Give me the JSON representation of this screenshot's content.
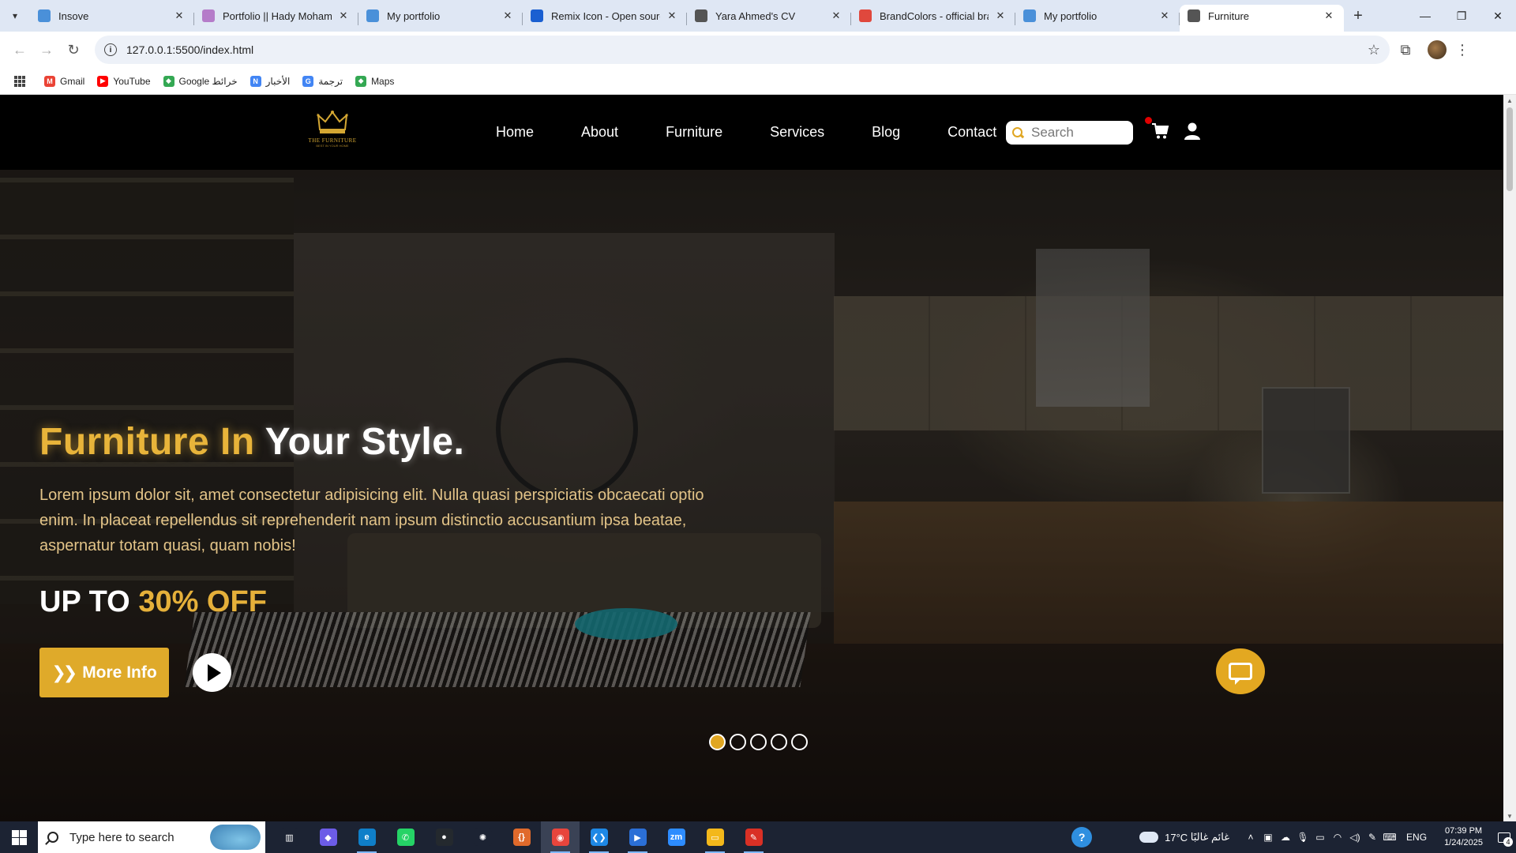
{
  "browser": {
    "tabs": [
      {
        "title": "Insove",
        "favicon_color": "#4a90d9",
        "active": false
      },
      {
        "title": "Portfolio || Hady Mohamed",
        "favicon_color": "#b57cc9",
        "active": false
      },
      {
        "title": "My portfolio",
        "favicon_color": "#4a90d9",
        "active": false
      },
      {
        "title": "Remix Icon - Open source",
        "favicon_color": "#1a5fd1",
        "active": false
      },
      {
        "title": "Yara Ahmed's CV",
        "favicon_color": "#555555",
        "active": false
      },
      {
        "title": "BrandColors - official bra",
        "favicon_color": "#e0483d",
        "active": false
      },
      {
        "title": "My portfolio",
        "favicon_color": "#4a90d9",
        "active": false
      },
      {
        "title": "Furniture",
        "favicon_color": "#555555",
        "active": true
      }
    ],
    "new_tab_icon": "plus-icon",
    "url": "127.0.0.1:5500/index.html",
    "bookmarks": [
      {
        "label": "Gmail",
        "icon": "gmail-icon",
        "color": "#ea4335",
        "glyph": "M"
      },
      {
        "label": "YouTube",
        "icon": "youtube-icon",
        "color": "#ff0000",
        "glyph": "▶"
      },
      {
        "label": "Google خرائط",
        "icon": "maps-icon",
        "color": "#34a853",
        "glyph": "◆"
      },
      {
        "label": "الأخبار",
        "icon": "news-icon",
        "color": "#4285f4",
        "glyph": "N"
      },
      {
        "label": "ترجمة",
        "icon": "translate-icon",
        "color": "#4285f4",
        "glyph": "G"
      },
      {
        "label": "Maps",
        "icon": "maps-icon",
        "color": "#34a853",
        "glyph": "◆"
      }
    ]
  },
  "site": {
    "logo": {
      "brand": "THE FURNITURE",
      "tagline": "BEST IN YOUR HOME",
      "color": "#d4a733"
    },
    "nav": [
      "Home",
      "About",
      "Furniture",
      "Services",
      "Blog",
      "Contact"
    ],
    "search_placeholder": "Search",
    "cart_badge_color": "#e10000",
    "accent": "#dfaa2a",
    "hero": {
      "title_gold": "Furniture In",
      "title_white": " Your Style.",
      "description": "Lorem ipsum dolor sit, amet consectetur adipisicing elit. Nulla quasi perspiciatis obcaecati optio enim. In placeat repellendus sit reprehenderit nam ipsum distinctio accusantium ipsa beatae, aspernatur totam quasi, quam nobis!",
      "offer_prefix": "UP TO ",
      "offer_value": "30% OFF",
      "more_button": "More Info",
      "play_icon": "play-icon",
      "slides": 5,
      "active_slide": 1
    },
    "chat_icon": "chat-icon"
  },
  "taskbar": {
    "search_placeholder": "Type here to search",
    "apps": [
      {
        "name": "task-view",
        "color": "#1c2333",
        "glyph": "▥"
      },
      {
        "name": "copilot",
        "color": "#6c5ce7",
        "glyph": "◆"
      },
      {
        "name": "edge",
        "color": "#0f7fc9",
        "glyph": "e"
      },
      {
        "name": "whatsapp",
        "color": "#25d366",
        "glyph": "✆"
      },
      {
        "name": "github",
        "color": "#24292e",
        "glyph": "●"
      },
      {
        "name": "chatgpt",
        "color": "#1c2333",
        "glyph": "✺"
      },
      {
        "name": "brackets",
        "color": "#e06a2b",
        "glyph": "{}"
      },
      {
        "name": "chrome",
        "color": "#e8453c",
        "glyph": "◉"
      },
      {
        "name": "vscode",
        "color": "#1e88e5",
        "glyph": "❮❯"
      },
      {
        "name": "media-player",
        "color": "#2b6fd6",
        "glyph": "▶"
      },
      {
        "name": "zoom",
        "color": "#2d8cff",
        "glyph": "zm"
      },
      {
        "name": "file-explorer",
        "color": "#f3b81b",
        "glyph": "▭"
      },
      {
        "name": "paint",
        "color": "#d93025",
        "glyph": "✎"
      }
    ],
    "weather_temp": "17°C",
    "weather_text": "غائم غالبًا",
    "language": "ENG",
    "time": "07:39 PM",
    "date": "1/24/2025",
    "notifications": "4"
  }
}
